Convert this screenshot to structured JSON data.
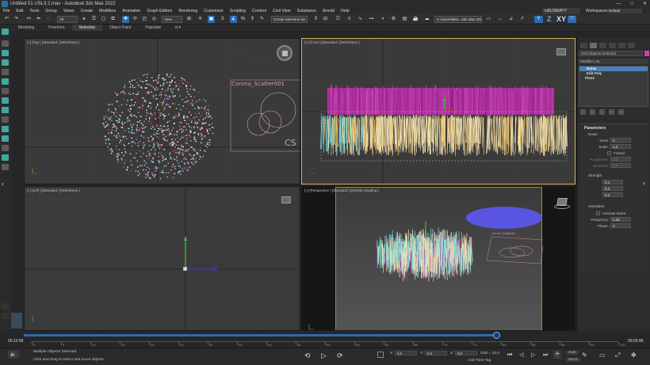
{
  "window": {
    "title": "Untitled 01 USL3 2.max - Autodesk 3ds Max 2022",
    "controls": [
      "—",
      "□",
      "✕"
    ]
  },
  "menu": {
    "items": [
      "File",
      "Edit",
      "Tools",
      "Group",
      "Views",
      "Create",
      "Modifiers",
      "Animation",
      "Graph Editors",
      "Rendering",
      "Customize",
      "Scripting",
      "Content",
      "Civil View",
      "Substance",
      "Arnold",
      "Help"
    ],
    "user": "inBUSMAYY",
    "workspaces_label": "Workspaces:",
    "workspace_value": "Default"
  },
  "toolbar": {
    "filter_value": "All",
    "reference_coord": "View",
    "selection_set": "Create Selection Se",
    "project_path": "C:\\Users\\Mea...3ds Max 2022",
    "axis_letters": [
      "Y",
      "Z",
      "XY"
    ]
  },
  "ribbon": {
    "tabs": [
      "Modeling",
      "Freeform",
      "Selection",
      "Object Paint",
      "Populate"
    ],
    "active": "Selection"
  },
  "viewports": {
    "top": {
      "label": "[+] [Top ] [Standard ] [Wireframe ]",
      "scatter_name": "Corona_Scatter001",
      "scatter_logo": "CS"
    },
    "front": {
      "label": "[+] [Front ] [Standard ] [Wireframe ]"
    },
    "left": {
      "label": "[+] [Left ] [Standard ] [Wireframe ]"
    },
    "perspective": {
      "label": "[+] [Perspective ] [Standard ] [Default Shading ]",
      "scatter_name": "Corona_Scatter001"
    }
  },
  "command_panel": {
    "object_name": "Grid Objects Selected",
    "object_color": "#d040b0",
    "modifier_list_label": "Modifier List",
    "stack": [
      {
        "label": "Noise",
        "selected": true
      },
      {
        "label": "Edit Poly",
        "selected": false
      },
      {
        "label": "Plane",
        "selected": false
      }
    ],
    "rollout_title": "Parameters",
    "noise_section": "Noise:",
    "seed_label": "Seed:",
    "seed_value": "0",
    "scale_label": "Scale:",
    "scale_value": "1,0",
    "fractal_label": "Fractal",
    "roughness_label": "Roughness:",
    "roughness_value": "0,0",
    "iterations_label": "Iterations:",
    "iterations_value": "6,0",
    "strength_section": "Strength:",
    "x_label": "X:",
    "x_value": "0,4",
    "y_label": "Y:",
    "y_value": "0,4",
    "z_label": "Z:",
    "z_value": "0,4",
    "animation_section": "Animation:",
    "animate_noise_label": "Animate Noise",
    "frequency_label": "Frequency:",
    "frequency_value": "0,25",
    "phase_label": "Phase:",
    "phase_value": "0"
  },
  "timeline": {
    "current_time": "00:12:59",
    "end_time": "00:03:48",
    "ticks": [
      "0",
      "5",
      "10",
      "15",
      "20",
      "25",
      "30",
      "35",
      "40",
      "45",
      "50",
      "55",
      "60",
      "65",
      "70",
      "75",
      "80",
      "85",
      "90",
      "95",
      "100"
    ],
    "position_fraction": 1.0
  },
  "status": {
    "selection_text": "Multiple Objects Selected",
    "prompt_text": "Click and drag to select and move objects",
    "x_label": "X:",
    "x_value": "0,0",
    "y_label": "Y:",
    "y_value": "0,0",
    "z_label": "Z:",
    "z_value": "0,0",
    "grid_text": "Grid = 10,0",
    "add_time_tag": "Add Time Tag",
    "auto_label": "Auto",
    "set_key_label": "Set K."
  },
  "colors": {
    "accent": "#2b6cb3",
    "magenta": "#c03ab0",
    "grass_cyan": "#7fe0e0",
    "grass_cream": "#efe0b0",
    "ellipse_blue": "#5a55e0",
    "active_border": "#d2b45a"
  }
}
